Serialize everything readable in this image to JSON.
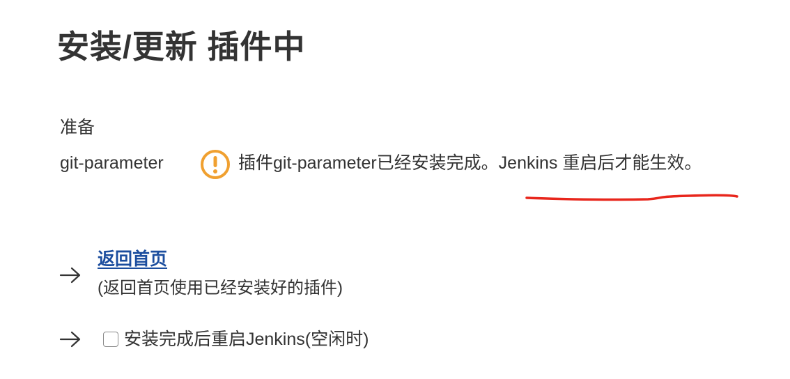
{
  "page": {
    "title": "安装/更新 插件中"
  },
  "install": {
    "prepare_label": "准备",
    "plugins": [
      {
        "name": "git-parameter",
        "status_icon": "warning-icon",
        "status_text": "插件git-parameter已经安装完成。Jenkins 重启后才能生效。"
      }
    ]
  },
  "actions": {
    "back_home_link": "返回首页",
    "back_home_description": "(返回首页使用已经安装好的插件)",
    "restart_checkbox_label": "安装完成后重启Jenkins(空闲时)",
    "restart_checked": false
  },
  "colors": {
    "warning": "#f0a030",
    "link": "#1b4d9e",
    "annotation": "#e8261c",
    "text": "#333333"
  }
}
